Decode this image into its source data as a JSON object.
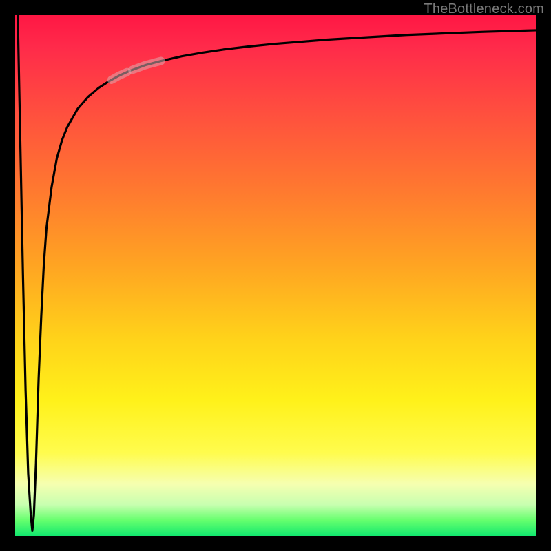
{
  "watermark": "TheBottleneck.com",
  "colors": {
    "frame": "#000000",
    "curve": "#000000",
    "highlight": "rgba(220,170,175,0.55)",
    "gradient_stops": [
      "#ff1744",
      "#ff4d3f",
      "#ff7a2f",
      "#ffa422",
      "#ffd21a",
      "#fff11a",
      "#fffc4d",
      "#f6ffb0",
      "#c8ffb0",
      "#66ff6e",
      "#12e86e"
    ]
  },
  "chart_data": {
    "type": "line",
    "title": "",
    "xlabel": "",
    "ylabel": "",
    "xlim": [
      0,
      100
    ],
    "ylim": [
      0,
      100
    ],
    "grid": false,
    "legend": false,
    "series": [
      {
        "name": "bottleneck-curve",
        "x": [
          0.5,
          1.0,
          1.5,
          2.0,
          2.5,
          3.0,
          3.3,
          3.6,
          4.0,
          4.5,
          5.0,
          5.5,
          6.0,
          7.0,
          8.0,
          9.0,
          10,
          12,
          14,
          16,
          18,
          20,
          22,
          25,
          28,
          32,
          36,
          40,
          45,
          50,
          55,
          60,
          65,
          70,
          75,
          80,
          85,
          90,
          95,
          100
        ],
        "y": [
          100,
          75,
          50,
          28,
          12,
          4,
          1,
          4,
          14,
          30,
          42,
          52,
          59,
          67,
          72.5,
          76,
          78.5,
          82,
          84.3,
          86,
          87.3,
          88.4,
          89.3,
          90.4,
          91.2,
          92.1,
          92.8,
          93.4,
          94.0,
          94.5,
          94.9,
          95.3,
          95.6,
          95.9,
          96.2,
          96.4,
          96.6,
          96.8,
          96.95,
          97.1
        ]
      }
    ],
    "highlights": [
      {
        "x_range": [
          18.5,
          21.5
        ],
        "note": "shaded segment on curve"
      },
      {
        "x_range": [
          22.5,
          28.0
        ],
        "note": "shaded segment on curve"
      }
    ]
  }
}
